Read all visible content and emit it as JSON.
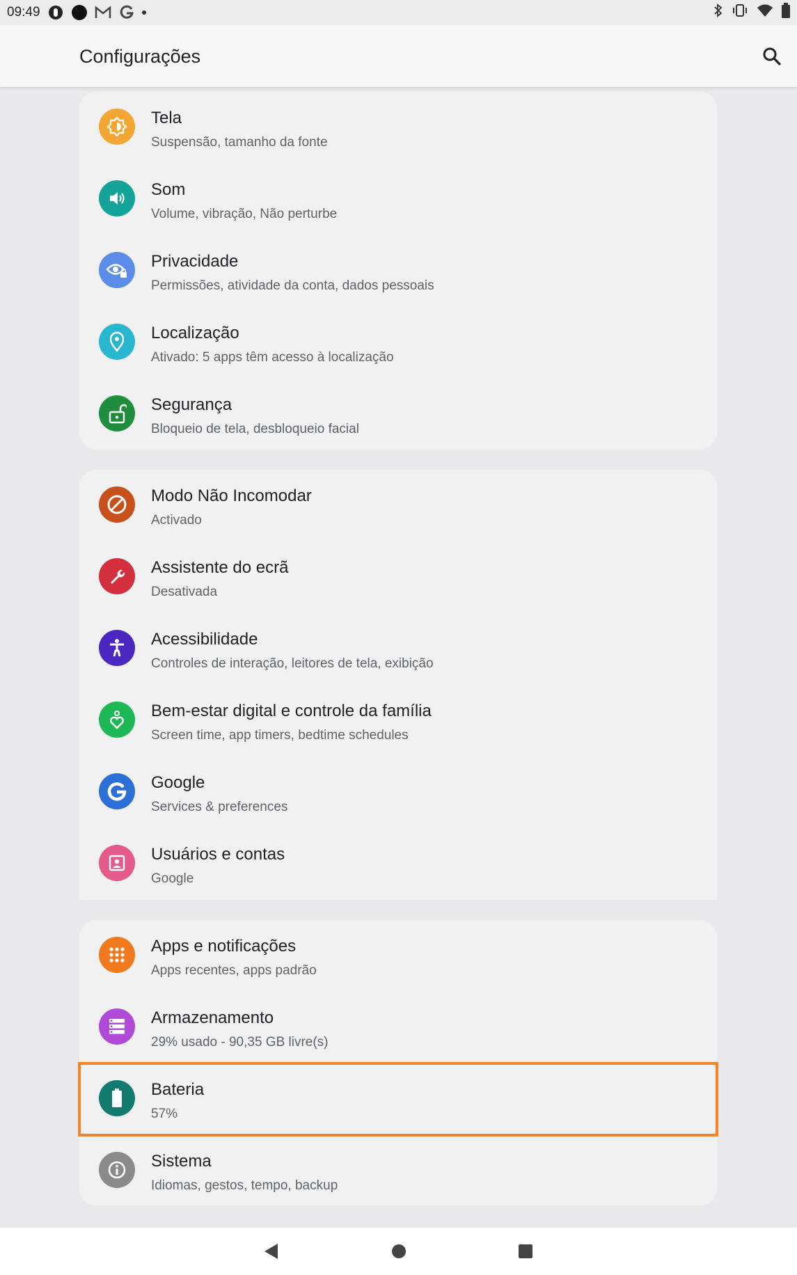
{
  "status": {
    "time": "09:49"
  },
  "appbar": {
    "title": "Configurações"
  },
  "groups": [
    [
      {
        "title": "Tela",
        "subtitle": "Suspensão, tamanho da fonte",
        "icon": "brightness-icon",
        "color": "#f2a633"
      },
      {
        "title": "Som",
        "subtitle": "Volume, vibração, Não perturbe",
        "icon": "volume-icon",
        "color": "#14a398"
      },
      {
        "title": "Privacidade",
        "subtitle": "Permissões, atividade da conta, dados pessoais",
        "icon": "eye-lock-icon",
        "color": "#5b8de8"
      },
      {
        "title": "Localização",
        "subtitle": "Ativado: 5 apps têm acesso à localização",
        "icon": "location-pin-icon",
        "color": "#29b6cf"
      },
      {
        "title": "Segurança",
        "subtitle": "Bloqueio de tela, desbloqueio facial",
        "icon": "unlock-icon",
        "color": "#1e8e3e"
      }
    ],
    [
      {
        "title": "Modo Não Incomodar",
        "subtitle": "Activado",
        "icon": "do-not-disturb-icon",
        "color": "#c8511b"
      },
      {
        "title": "Assistente do ecrã",
        "subtitle": "Desativada",
        "icon": "wrench-icon",
        "color": "#d32f3c"
      },
      {
        "title": "Acessibilidade",
        "subtitle": "Controles de interação, leitores de tela, exibição",
        "icon": "accessibility-icon",
        "color": "#4a27c0"
      },
      {
        "title": "Bem-estar digital e controle da família",
        "subtitle": "Screen time, app timers, bedtime schedules",
        "icon": "wellbeing-heart-icon",
        "color": "#1fb856"
      },
      {
        "title": "Google",
        "subtitle": "Services & preferences",
        "icon": "google-g-icon",
        "color": "#2c6fd6"
      },
      {
        "title": "Usuários e contas",
        "subtitle": "Google",
        "icon": "account-box-icon",
        "color": "#e35a8b"
      }
    ],
    [
      {
        "title": "Apps e notificações",
        "subtitle": "Apps recentes, apps padrão",
        "icon": "apps-grid-icon",
        "color": "#f07a1d"
      },
      {
        "title": "Armazenamento",
        "subtitle": "29% usado - 90,35 GB livre(s)",
        "icon": "storage-icon",
        "color": "#b14ad9"
      },
      {
        "title": "Bateria",
        "subtitle": "57%",
        "icon": "battery-icon",
        "color": "#137a70"
      },
      {
        "title": "Sistema",
        "subtitle": "Idiomas, gestos, tempo, backup",
        "icon": "info-icon",
        "color": "#8a8a8a"
      }
    ]
  ],
  "highlight_color": "#f5832a"
}
